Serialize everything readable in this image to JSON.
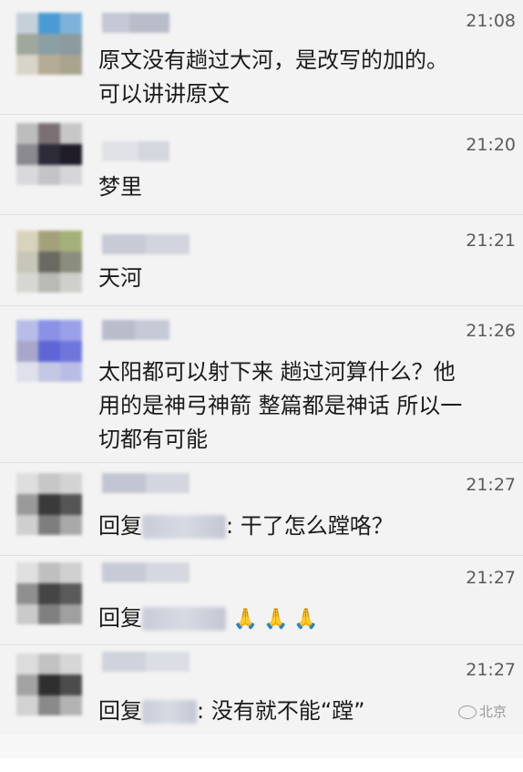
{
  "messages": [
    {
      "time": "21:08",
      "text": "原文没有趟过大河，是改写的加的。\n可以讲讲原文"
    },
    {
      "time": "21:20",
      "text": "梦里"
    },
    {
      "time": "21:21",
      "text": "天河"
    },
    {
      "time": "21:26",
      "text": "太阳都可以射下来 趟过河算什么？他\n用的是神弓神箭 整篇都是神话 所以一\n切都有可能"
    },
    {
      "time": "21:27",
      "reply_prefix": "回复",
      "text": ": 干了怎么蹚咯？"
    },
    {
      "time": "21:27",
      "reply_prefix": "回复",
      "emoji_text": "🙏🙏🙏"
    },
    {
      "time": "21:27",
      "reply_prefix": "回复",
      "text": ": 没有就不能“蹚”"
    }
  ],
  "watermark": {
    "text": "北京"
  },
  "colors": {
    "background": "#f3f3f3",
    "text": "#1b1b1b",
    "time": "#5b5b5b",
    "divider": "#e2e2e2"
  }
}
